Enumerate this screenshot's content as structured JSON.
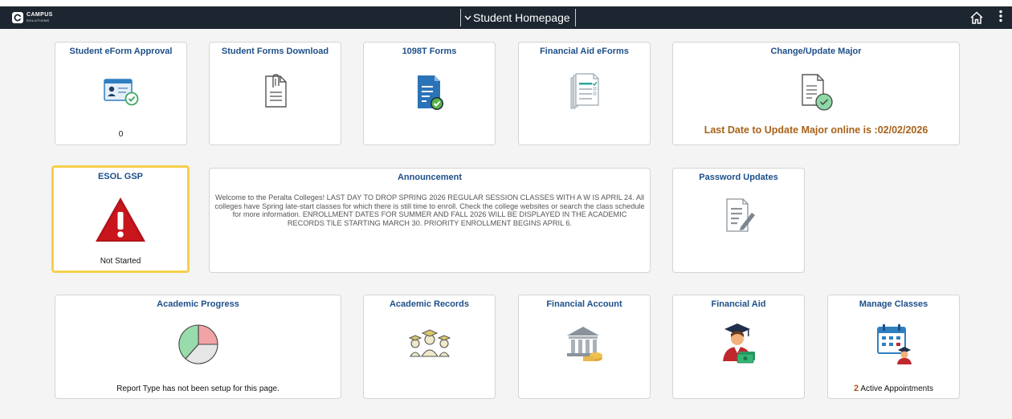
{
  "header": {
    "logo_text": "CAMPUS",
    "logo_subtext": "SOLUTIONS",
    "page_title": "Student Homepage",
    "icons": {
      "title_chevron": "chevron-down-icon",
      "home": "home-icon",
      "actions": "more-vertical-icon"
    }
  },
  "tiles": {
    "eform_approval": {
      "title": "Student eForm Approval",
      "count": "0",
      "icon": "id-card-check-icon"
    },
    "forms_download": {
      "title": "Student Forms Download",
      "icon": "document-paperclip-icon"
    },
    "t1098": {
      "title": "1098T Forms",
      "icon": "document-check-icon"
    },
    "fa_eforms": {
      "title": "Financial Aid eForms",
      "icon": "document-stack-icon"
    },
    "change_major": {
      "title": "Change/Update Major",
      "deadline": "Last Date to Update Major online is :02/02/2026",
      "icon": "document-check-circle-icon"
    },
    "esol_gsp": {
      "title": "ESOL GSP",
      "status": "Not Started",
      "icon": "warning-triangle-icon"
    },
    "announcement": {
      "title": "Announcement",
      "text": "Welcome to the Peralta Colleges! LAST DAY TO DROP SPRING 2026 REGULAR SESSION CLASSES WITH A W IS APRIL 24. All colleges have Spring late-start classes for which there is still time to enroll. Check the college websites or search the class schedule for more information. ENROLLMENT DATES FOR SUMMER AND FALL 2026 WILL BE DISPLAYED IN THE ACADEMIC RECORDS TILE STARTING MARCH 30. PRIORITY ENROLLMENT BEGINS APRIL 6."
    },
    "password_updates": {
      "title": "Password Updates",
      "icon": "document-pencil-icon"
    },
    "academic_progress": {
      "title": "Academic Progress",
      "message": "Report Type has not been setup for this page.",
      "icon": "pie-chart-icon"
    },
    "academic_records": {
      "title": "Academic Records",
      "icon": "graduates-icon"
    },
    "financial_account": {
      "title": "Financial Account",
      "icon": "bank-money-icon"
    },
    "financial_aid": {
      "title": "Financial Aid",
      "icon": "graduate-money-icon"
    },
    "manage_classes": {
      "title": "Manage Classes",
      "appointments_count": "2",
      "appointments_label": "Active Appointments",
      "icon": "calendar-person-icon"
    }
  },
  "colors": {
    "header_bg": "#1c2530",
    "tile_title": "#1d4f8a",
    "deadline_text": "#a8621a",
    "highlight_border": "#f5d04b",
    "warning_red": "#b3131a"
  }
}
